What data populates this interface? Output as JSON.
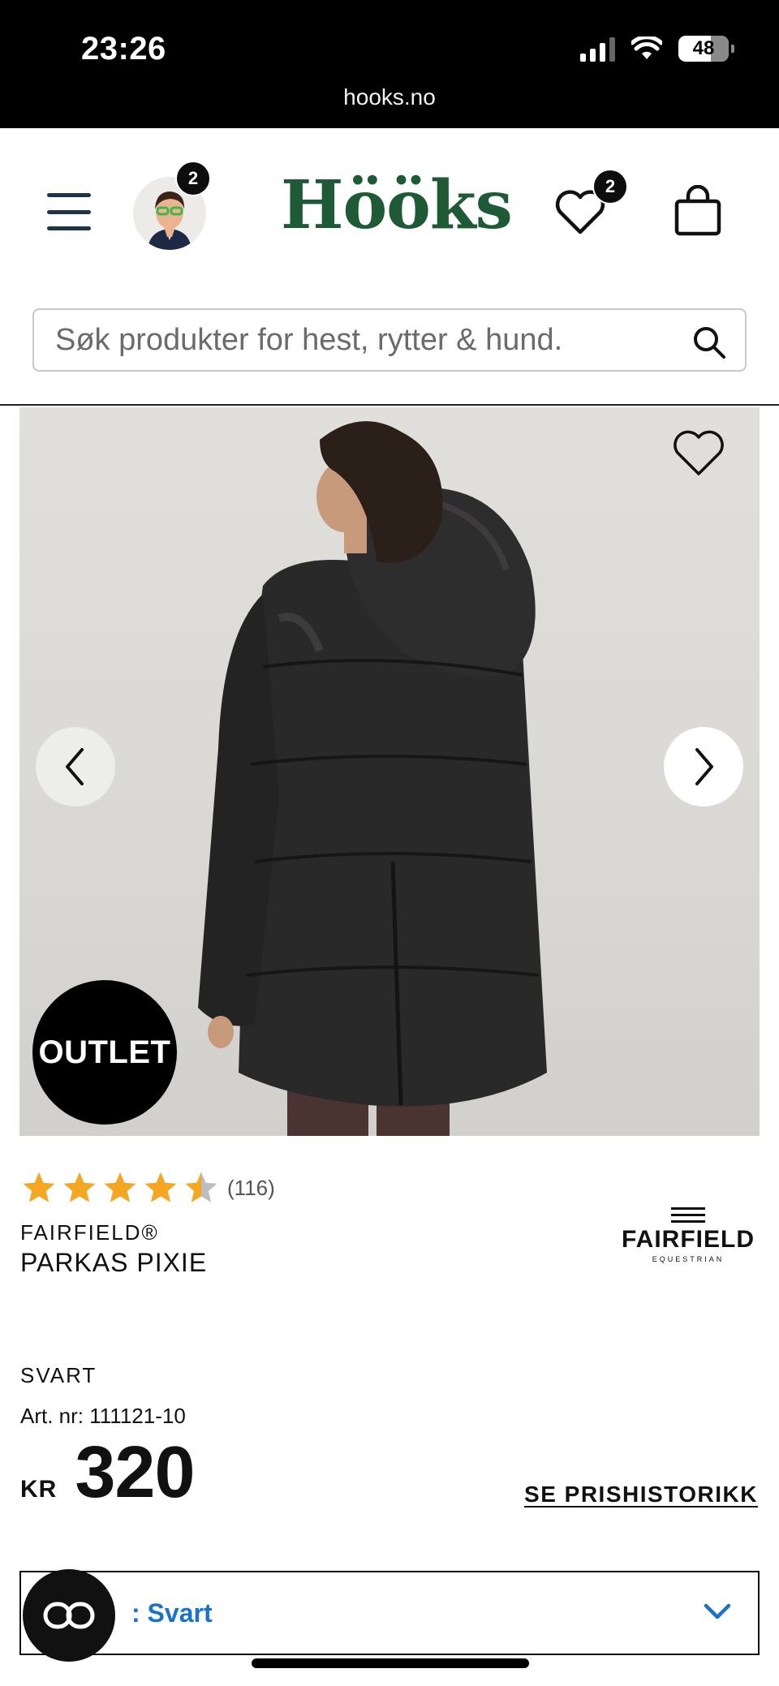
{
  "status_bar": {
    "time": "23:26",
    "battery": "48",
    "url": "hooks.no"
  },
  "header": {
    "logo": "Hööks",
    "avatar_badge": "2",
    "favorites_badge": "2",
    "icons": [
      "menu-icon",
      "avatar",
      "heart-icon",
      "shopping-bag-icon"
    ]
  },
  "search": {
    "placeholder": "Søk produkter for hest, rytter & hund."
  },
  "product": {
    "image_badge": "OUTLET",
    "rating_value": 4.5,
    "rating_count": "(116)",
    "brand": "FAIRFIELD®",
    "name": "PARKAS PIXIE",
    "brand_logo": {
      "name": "FAIRFIELD",
      "sub": "EQUESTRIAN"
    },
    "color": "SVART",
    "article_number": "Art. nr: 111121-10",
    "price_currency": "KR",
    "price_value": "320",
    "price_history_link": "SE PRISHISTORIKK"
  },
  "variant_select": {
    "value": "Svart"
  },
  "colors": {
    "logo_green": "#1f5a36",
    "star": "#f5a623",
    "link_blue": "#1a73c9"
  }
}
